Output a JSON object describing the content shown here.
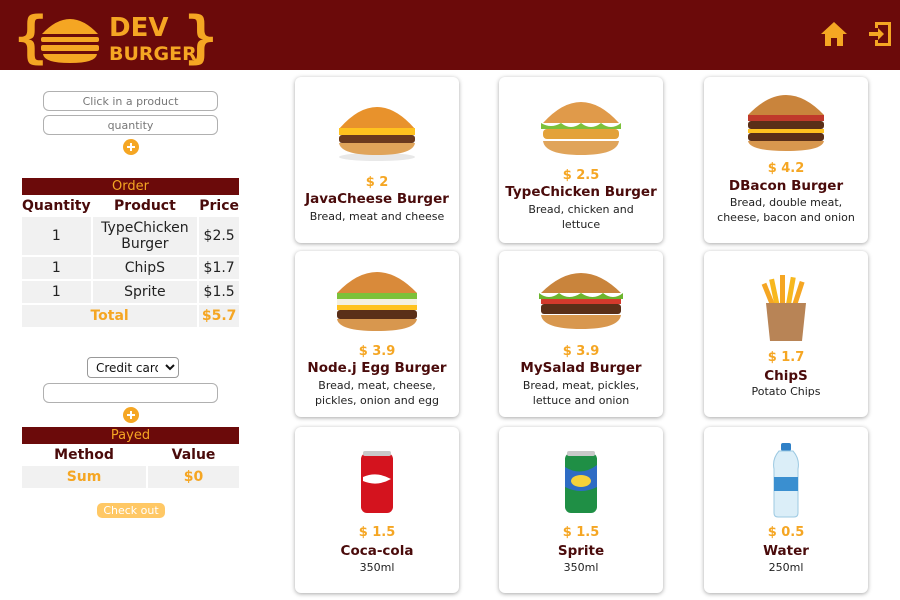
{
  "brand": {
    "text_top": "DEV",
    "text_bottom": "BURGER",
    "color_primary": "#6b0a0a",
    "color_accent": "#f5a623"
  },
  "header": {
    "icons": [
      "home-icon",
      "exit-icon"
    ]
  },
  "form": {
    "product_placeholder": "Click in a product",
    "quantity_placeholder": "quantity"
  },
  "order": {
    "caption": "Order",
    "headers": [
      "Quantity",
      "Product",
      "Price"
    ],
    "rows": [
      {
        "quantity": "1",
        "product": "TypeChicken Burger",
        "price": "$2.5"
      },
      {
        "quantity": "1",
        "product": "ChipS",
        "price": "$1.7"
      },
      {
        "quantity": "1",
        "product": "Sprite",
        "price": "$1.5"
      }
    ],
    "total_label": "Total",
    "total_value": "$5.7"
  },
  "payment": {
    "selected_method": "Credit card",
    "amount_value": ""
  },
  "payed": {
    "caption": "Payed",
    "headers": [
      "Method",
      "Value"
    ],
    "sum_label": "Sum",
    "sum_value": "$0"
  },
  "checkout_label": "Check out",
  "products": [
    {
      "price": "$ 2",
      "name": "JavaCheese Burger",
      "desc": "Bread, meat and cheese",
      "icon": "burger-icon"
    },
    {
      "price": "$ 2.5",
      "name": "TypeChicken Burger",
      "desc": "Bread, chicken and lettuce",
      "icon": "burger-icon"
    },
    {
      "price": "$ 4.2",
      "name": "DBacon Burger",
      "desc": "Bread, double meat, cheese, bacon and onion",
      "icon": "burger-icon"
    },
    {
      "price": "$ 3.9",
      "name": "Node.j Egg Burger",
      "desc": "Bread, meat, cheese, pickles, onion and egg",
      "icon": "burger-icon"
    },
    {
      "price": "$ 3.9",
      "name": "MySalad Burger",
      "desc": "Bread, meat, pickles, lettuce and onion",
      "icon": "burger-icon"
    },
    {
      "price": "$ 1.7",
      "name": "ChipS",
      "desc": "Potato Chips",
      "icon": "fries-icon"
    },
    {
      "price": "$ 1.5",
      "name": "Coca-cola",
      "desc": "350ml",
      "icon": "can-icon"
    },
    {
      "price": "$ 1.5",
      "name": "Sprite",
      "desc": "350ml",
      "icon": "can-icon"
    },
    {
      "price": "$ 0.5",
      "name": "Water",
      "desc": "250ml",
      "icon": "bottle-icon"
    }
  ]
}
